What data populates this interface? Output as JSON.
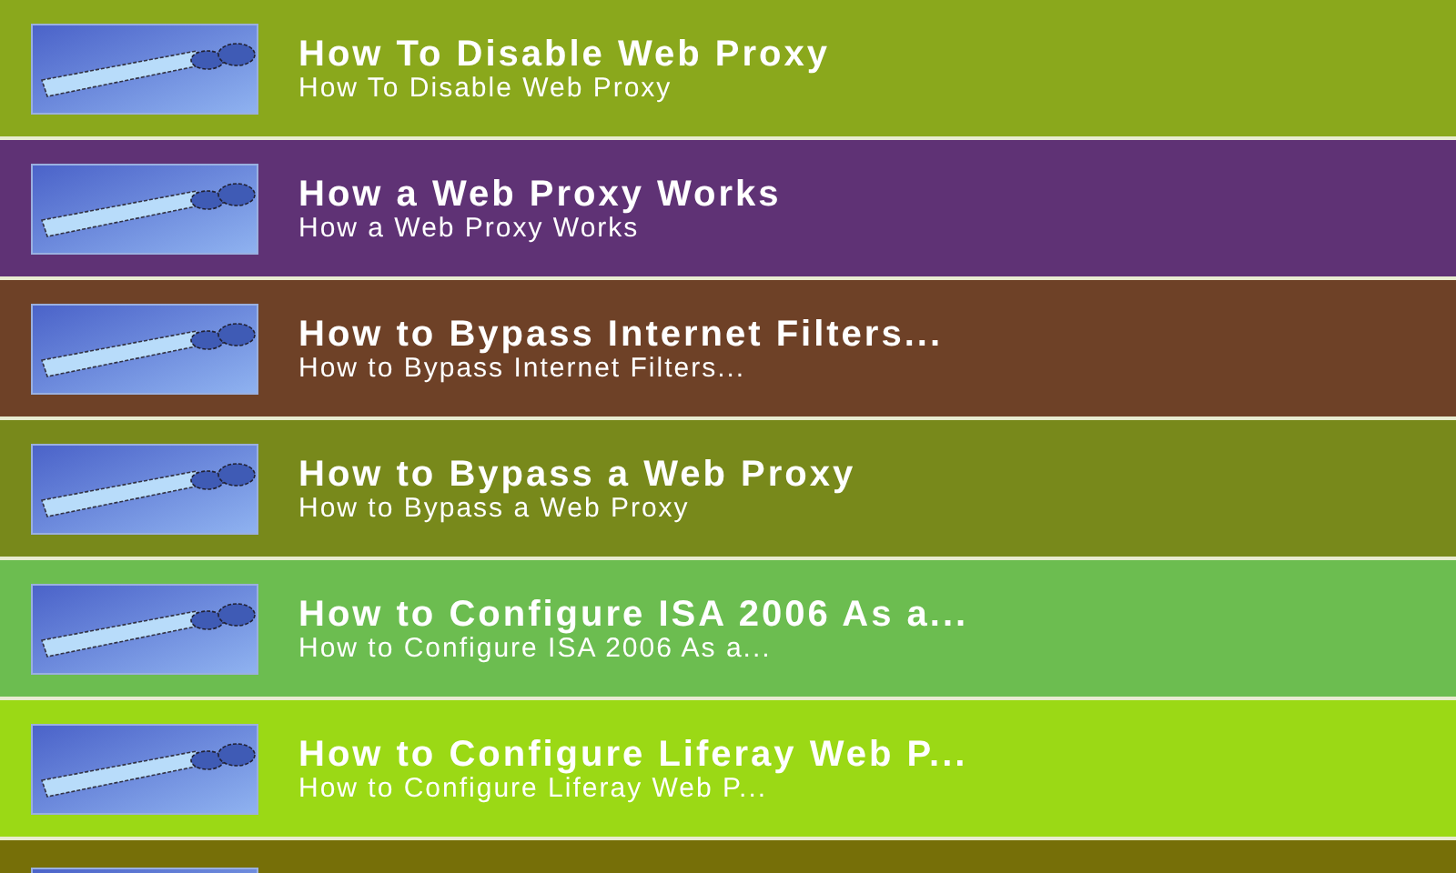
{
  "items": [
    {
      "title": "How To Disable Web Proxy",
      "subtitle": "How To Disable Web Proxy",
      "color": "#8aa81c"
    },
    {
      "title": "How a Web Proxy Works",
      "subtitle": "How a Web Proxy Works",
      "color": "#5f3275"
    },
    {
      "title": "How to Bypass Internet Filters...",
      "subtitle": "How to Bypass Internet Filters...",
      "color": "#6e4127"
    },
    {
      "title": "How to Bypass a Web Proxy",
      "subtitle": "How to Bypass a Web Proxy",
      "color": "#78891b"
    },
    {
      "title": "How to Configure ISA 2006 As a...",
      "subtitle": "How to Configure ISA 2006 As a...",
      "color": "#6cbd50"
    },
    {
      "title": "How to Configure Liferay Web P...",
      "subtitle": "How to Configure Liferay Web P...",
      "color": "#9bd915"
    }
  ],
  "partial_row": {
    "color": "#766f08"
  }
}
